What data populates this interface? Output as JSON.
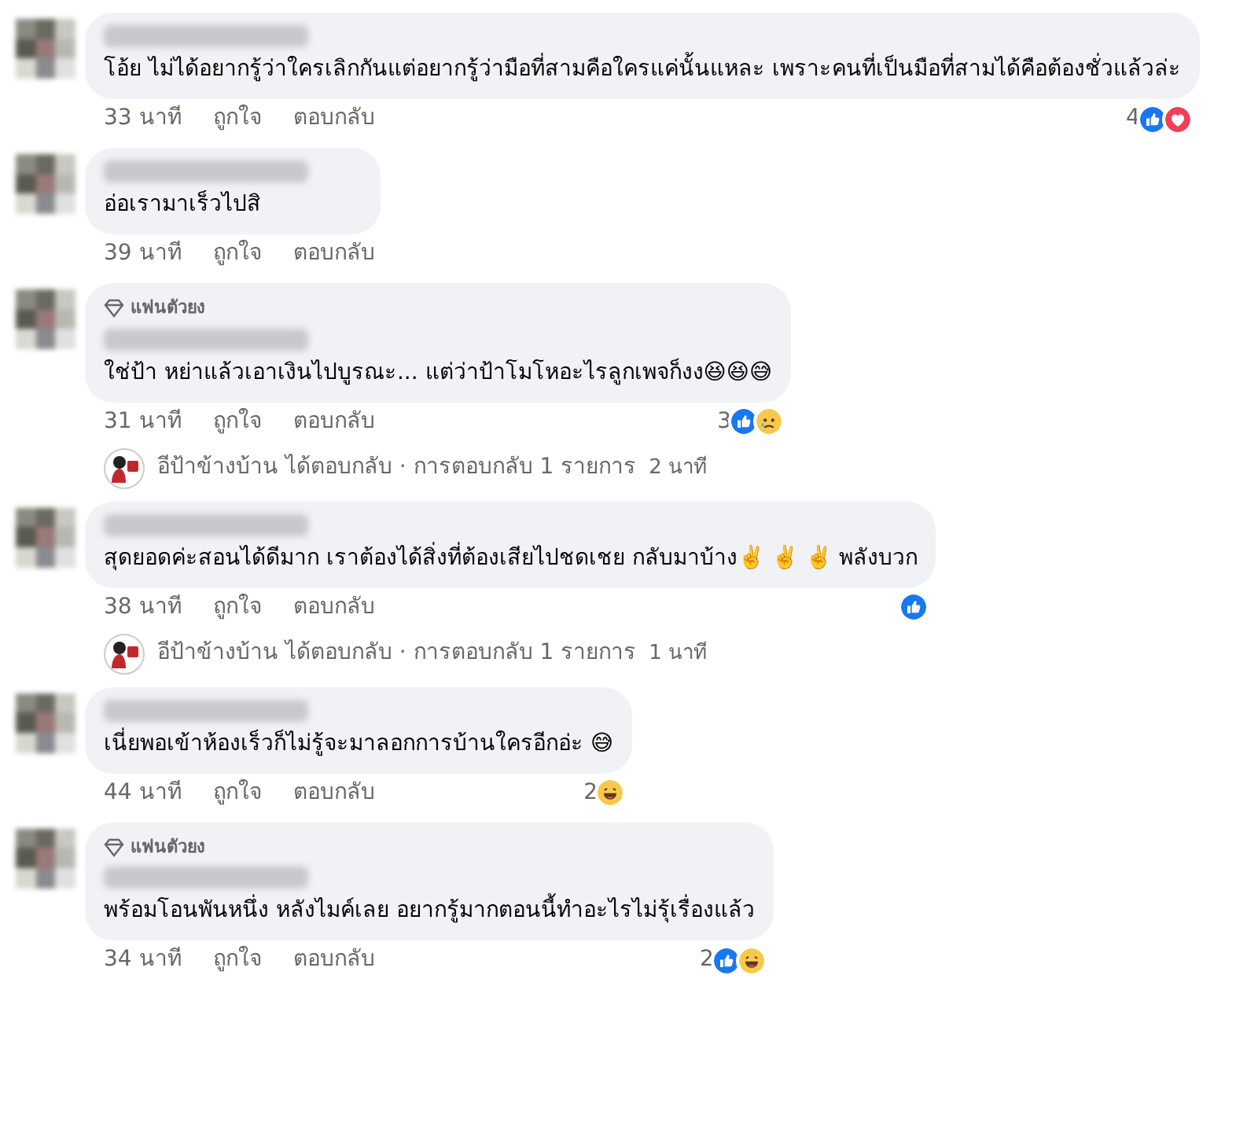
{
  "comments": [
    {
      "text": "โอ้ย ไม่ได้อยากรู้ว่าใครเลิกกันแต่อยากรู้ว่ามือที่สามคือใครแค่นั้นแหละ เพราะคนที่เป็นมือที่สามได้คือต้องชั่วแล้วล่ะ",
      "time": "33 นาที",
      "like": "ถูกใจ",
      "reply": "ตอบกลับ",
      "reaction_count": "4",
      "reactions": [
        {
          "kind": "like"
        },
        {
          "kind": "love"
        }
      ]
    },
    {
      "text": "อ่อเรามาเร็วไปสิ",
      "time": "39 นาที",
      "like": "ถูกใจ",
      "reply": "ตอบกลับ"
    },
    {
      "badge": "แฟนตัวยง",
      "text": "ใช่ป้า หย่าแล้วเอาเงินไปบูรณะ... แต่ว่าป้าโมโหอะไรลูกเพจก็งง😆😆😅",
      "time": "31 นาที",
      "like": "ถูกใจ",
      "reply": "ตอบกลับ",
      "reaction_count": "3",
      "reactions": [
        {
          "kind": "like"
        },
        {
          "kind": "sad"
        }
      ],
      "replies": {
        "author": "อีป้าข้างบ้าน",
        "action": "ได้ตอบกลับ · การตอบกลับ 1 รายการ",
        "time": "2 นาที"
      }
    },
    {
      "text": "สุดยอดค่ะสอนได้ดีมาก เราต้องได้สิ่งที่ต้องเสียไปชดเชย กลับมาบ้าง✌️ ✌️ ✌️ พลังบวก",
      "time": "38 นาที",
      "like": "ถูกใจ",
      "reply": "ตอบกลับ",
      "reactions": [
        {
          "kind": "like"
        }
      ],
      "replies": {
        "author": "อีป้าข้างบ้าน",
        "action": "ได้ตอบกลับ · การตอบกลับ 1 รายการ",
        "time": "1 นาที"
      }
    },
    {
      "text": "เนี่ยพอเข้าห้องเร็วก็ไม่รู้จะมาลอกการบ้านใครอีกอ่ะ 😅",
      "time": "44 นาที",
      "like": "ถูกใจ",
      "reply": "ตอบกลับ",
      "reaction_count": "2",
      "reactions": [
        {
          "kind": "haha"
        }
      ]
    },
    {
      "badge": "แฟนตัวยง",
      "text": "พร้อมโอนพันหนึ่ง หลังไมค์เลย อยากรู้มากตอนนี้ทำอะไรไม่รุ้เรื่องแล้ว",
      "time": "34 นาที",
      "like": "ถูกใจ",
      "reply": "ตอบกลับ",
      "reaction_count": "2",
      "reactions": [
        {
          "kind": "like"
        },
        {
          "kind": "haha"
        }
      ]
    }
  ]
}
